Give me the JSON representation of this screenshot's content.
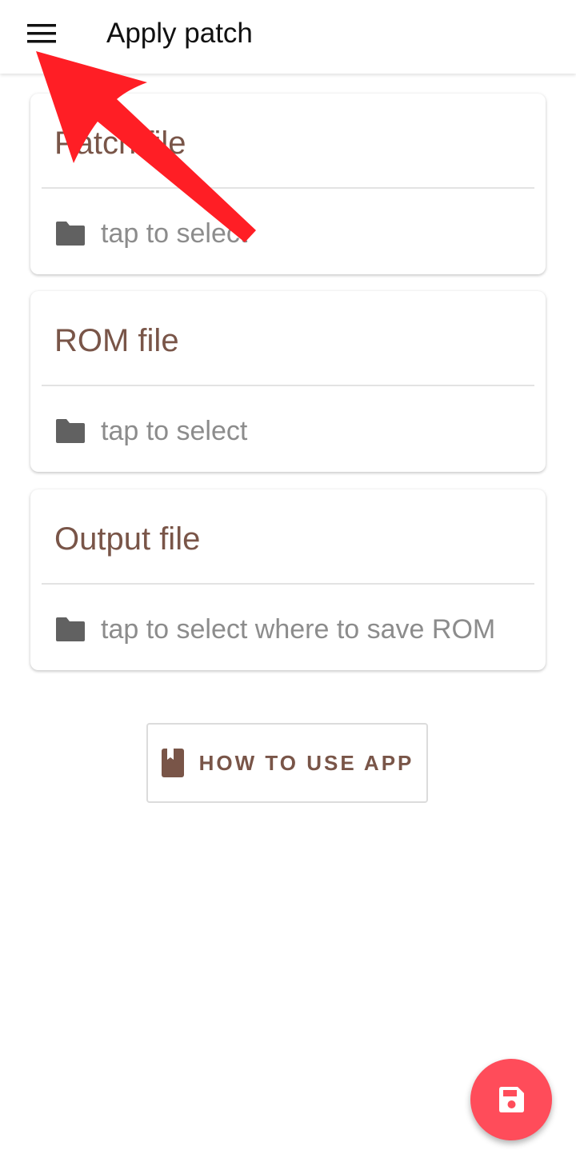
{
  "appbar": {
    "title": "Apply patch",
    "menu_icon": "hamburger-menu-icon"
  },
  "cards": {
    "patch": {
      "title": "Patch file",
      "select_text": "tap to select",
      "icon": "folder-icon"
    },
    "rom": {
      "title": "ROM file",
      "select_text": "tap to select",
      "icon": "folder-icon"
    },
    "output": {
      "title": "Output file",
      "select_text": "tap to select where to save ROM",
      "icon": "folder-icon"
    }
  },
  "howto": {
    "label": "HOW TO USE APP",
    "icon": "book-icon"
  },
  "fab": {
    "icon": "save-icon"
  },
  "colors": {
    "accent_brown": "#795548",
    "fab_red": "#ff4c5a",
    "annotation_red": "#ff1e25",
    "icon_gray": "#616161",
    "secondary_text": "#8c8c8c"
  }
}
